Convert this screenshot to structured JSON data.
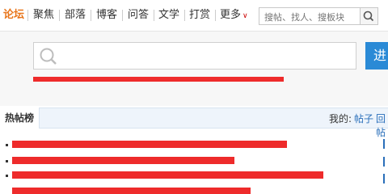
{
  "topnav": {
    "items": [
      "论坛",
      "聚焦",
      "部落",
      "博客",
      "问答",
      "文学",
      "打赏",
      "更多"
    ],
    "more_arrow": "∨",
    "search_placeholder": "搜帖、找人、搜板块"
  },
  "main_search": {
    "button_label": "进"
  },
  "hot_posts": {
    "tab_label": "热帖榜",
    "my_label": "我的:",
    "links": [
      "帖子",
      "回帖"
    ]
  },
  "colors": {
    "accent": "#e8751a",
    "button": "#2a8ad6",
    "redaction": "#ee2b2b"
  }
}
